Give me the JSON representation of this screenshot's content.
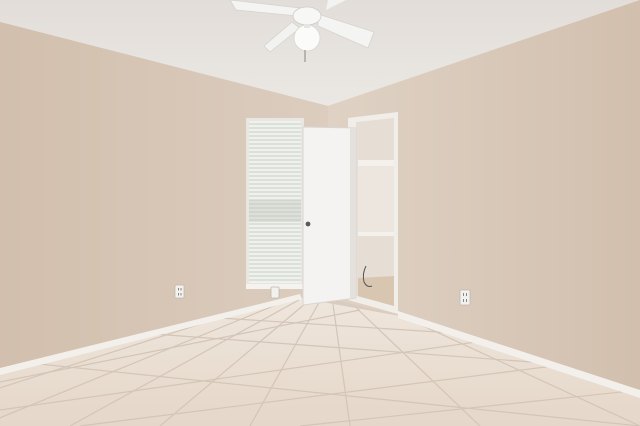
{
  "scene": {
    "description_label": "",
    "colors": {
      "ceiling": "#e6e2de",
      "left_wall": "#d7c6b6",
      "right_wall": "#d9c9b9",
      "floor": "#e8dccf",
      "grout": "#d2c4b6",
      "baseboard": "#f2efeb",
      "door": "#f4f3f1",
      "closet_interior": "#e9e3dc",
      "window_blind": "#eef0ec",
      "outlet": "#f3f1ed"
    },
    "icons": {
      "ceiling_fan": "ceiling-fan-icon",
      "outlet": "outlet-icon"
    }
  }
}
